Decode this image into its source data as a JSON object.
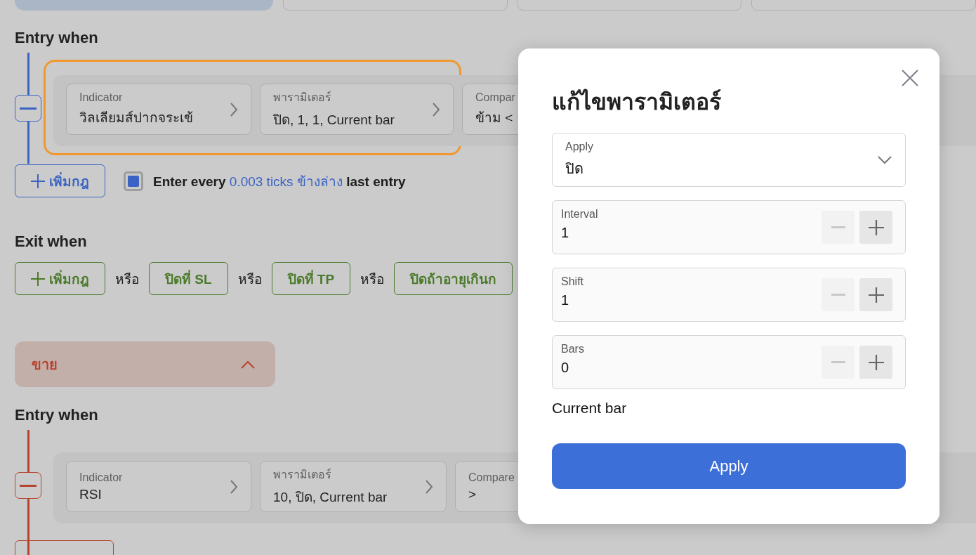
{
  "buy_entry": {
    "heading": "Entry when",
    "color": "#3b63c4",
    "highlighted": true,
    "conditions": [
      {
        "label": "Indicator",
        "value": "วิลเลียมส์ปากจระเข้"
      },
      {
        "label": "พารามิเตอร์",
        "value": "ปิด, 1, 1, Current bar"
      },
      {
        "label": "Compar",
        "value": "ข้าม <"
      }
    ],
    "add_button": "เพิ่มกฎ",
    "repeat": {
      "checked": true,
      "text": "Enter every",
      "link": "0.003 ticks ข้างล่าง",
      "tail": "last entry"
    }
  },
  "buy_exit": {
    "heading": "Exit when",
    "add_button": "เพิ่มกฎ",
    "rules": [
      {
        "separator": "หรือ",
        "label": "ปิดที่ SL"
      },
      {
        "separator": "หรือ",
        "label": "ปิดที่ TP"
      },
      {
        "separator": "หรือ",
        "label": "ปิดถ้าอายุเกินก"
      }
    ]
  },
  "sell_section": {
    "title": "ขาย",
    "expanded": true,
    "color": "#b5452e"
  },
  "sell_entry": {
    "heading": "Entry when",
    "color": "#b5452e",
    "conditions": [
      {
        "label": "Indicator",
        "value": "RSI"
      },
      {
        "label": "พารามิเตอร์",
        "value": "10, ปิด, Current bar"
      },
      {
        "label": "Compare",
        "value": ">"
      }
    ]
  },
  "dialog": {
    "title": "แก้ไขพารามิเตอร์",
    "select": {
      "label": "Apply",
      "value": "ปิด"
    },
    "fields": [
      {
        "label": "Interval",
        "value": "1",
        "decrement_disabled": true
      },
      {
        "label": "Shift",
        "value": "1",
        "decrement_disabled": true
      },
      {
        "label": "Bars",
        "value": "0",
        "decrement_disabled": true
      }
    ],
    "summary": "Current bar",
    "apply": "Apply"
  }
}
